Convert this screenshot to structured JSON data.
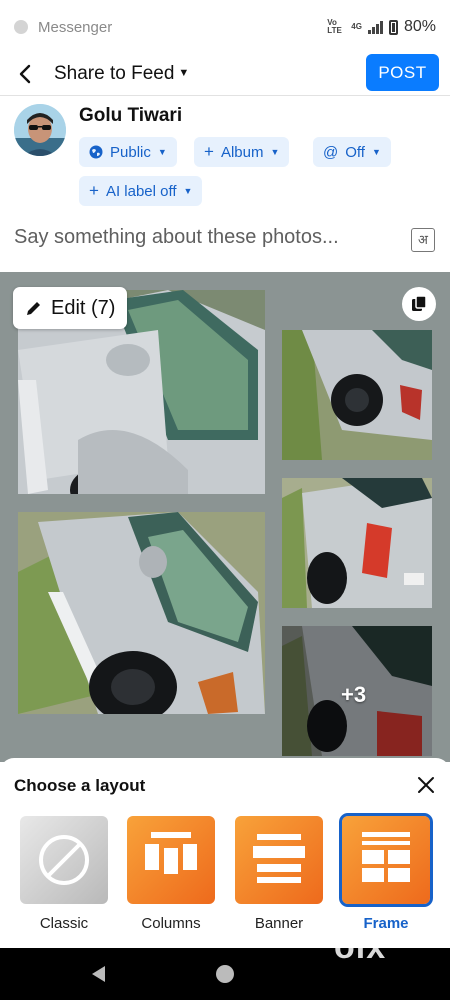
{
  "status_bar": {
    "app_name": "Messenger",
    "network_small": "Vo LTE",
    "network_type": "4G",
    "battery": "80%"
  },
  "header": {
    "title": "Share to Feed",
    "post_label": "POST"
  },
  "profile": {
    "name": "Golu Tiwari",
    "chips": {
      "audience": "Public",
      "album": "Album",
      "off": "Off",
      "ai_label": "AI label off"
    }
  },
  "composer": {
    "placeholder": "Say something about these photos...",
    "lang_icon": "अ"
  },
  "photos": {
    "edit_label": "Edit (7)",
    "more_count": "+3"
  },
  "layout_sheet": {
    "title": "Choose a layout",
    "options": [
      {
        "label": "Classic",
        "icon": "no-layout-icon"
      },
      {
        "label": "Columns",
        "icon": "columns-layout-icon"
      },
      {
        "label": "Banner",
        "icon": "banner-layout-icon"
      },
      {
        "label": "Frame",
        "icon": "frame-layout-icon"
      }
    ],
    "selected": "Frame",
    "accent": "#1762c9",
    "orange": "#f5851f"
  },
  "watermark": "olx"
}
